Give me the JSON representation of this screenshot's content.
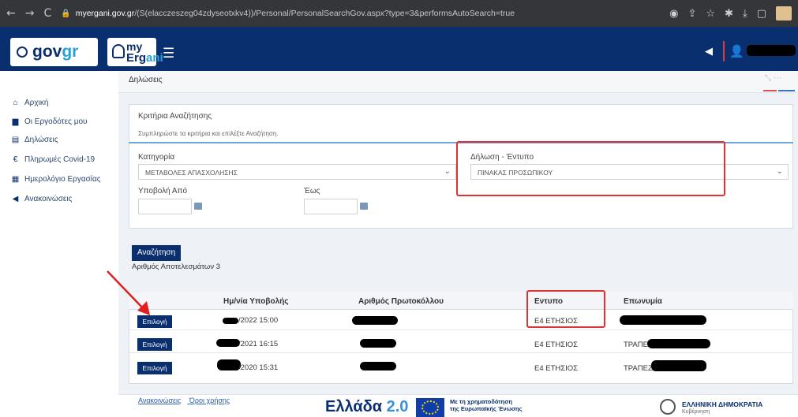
{
  "browser": {
    "url_domain": "myergani.gov.gr",
    "url_path": "/(S(elacczeszeg04zdyseotxkv4))/Personal/PersonalSearchGov.aspx?type=3&performsAutoSearch=true"
  },
  "header": {
    "gov_logo_a": "gov",
    "gov_logo_b": "gr",
    "ergani_my": "my",
    "ergani_a": "Erg",
    "ergani_b": "ani",
    "menu_icon": "☰"
  },
  "sidebar": {
    "items": [
      {
        "label": "Αρχική",
        "icon": "home-icon"
      },
      {
        "label": "Οι Εργοδότες μου",
        "icon": "employer-icon"
      },
      {
        "label": "Δηλώσεις",
        "icon": "declarations-icon"
      },
      {
        "label": "Πληρωμές Covid-19",
        "icon": "euro-icon"
      },
      {
        "label": "Ημερολόγιο Εργασίας",
        "icon": "calendar-icon"
      },
      {
        "label": "Ανακοινώσεις",
        "icon": "megaphone-icon"
      }
    ]
  },
  "breadcrumb": "Δηλώσεις",
  "criteria": {
    "title": "Κριτήρια Αναζήτησης",
    "subtitle": "Συμπληρώστε τα κριτήρια και επιλέξτε Αναζήτηση.",
    "category_label": "Κατηγορία",
    "category_value": "ΜΕΤΑΒΟΛΕΣ ΑΠΑΣΧΟΛΗΣΗΣ",
    "form_label": "Δήλωση - Έντυπο",
    "form_value": "ΠΙΝΑΚΑΣ ΠΡΟΣΩΠΙΚΟΥ",
    "from_label": "Υποβολή Από",
    "to_label": "Έως"
  },
  "search_button": "Αναζήτηση",
  "results_count": "Αριθμός Αποτελεσμάτων 3",
  "table": {
    "headers": [
      "Ημ/νία Υποβολής",
      "Αριθμός Πρωτοκόλλου",
      "Εντυπο",
      "Επωνυμία"
    ],
    "rows": [
      {
        "action": "Επιλογή",
        "date": "/2022 15:00",
        "form": "Ε4 ΕΤΗΣΙΟΣ",
        "name": ""
      },
      {
        "action": "Επιλογή",
        "date": "/2021 16:15",
        "form": "Ε4 ΕΤΗΣΙΟΣ",
        "name": "ΤΡΑΠΕΖΑ"
      },
      {
        "action": "Επιλογή",
        "date": "/2020 15:31",
        "form": "Ε4 ΕΤΗΣΙΟΣ",
        "name": "ΤΡΑΠΕΖΑ"
      }
    ]
  },
  "footer": {
    "links": [
      "Ανακοινώσεις",
      "Όροι χρήσης"
    ],
    "ellada_a": "Ελλάδα",
    "ellada_b": "2.0",
    "eu_line1": "Με τη χρηματοδότηση",
    "eu_line2": "της Ευρωπαϊκής Ένωσης",
    "hellenic": "ΕΛΛΗΝΙΚΗ ΔΗΜΟΚΡΑΤΙΑ",
    "hellenic_sub": "Κυβέρνηση"
  },
  "colors": {
    "brand_navy": "#0a2f6e",
    "accent_blue": "#26a1d9",
    "highlight_red": "#d33333"
  }
}
